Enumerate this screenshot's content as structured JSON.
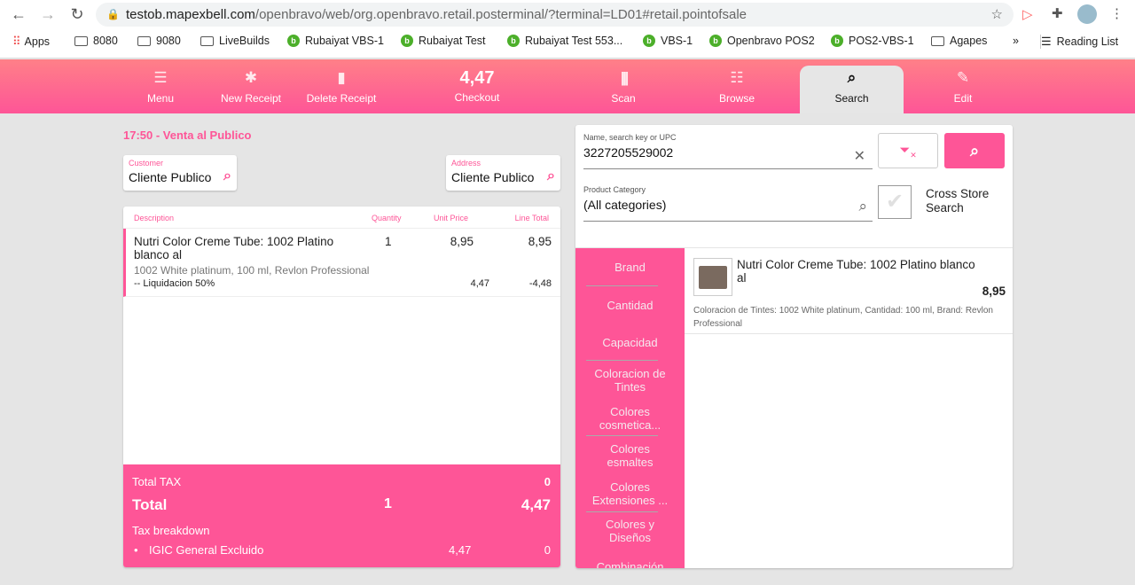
{
  "browser": {
    "url_host": "testob.mapexbell.com",
    "url_path": "/openbravo/web/org.openbravo.retail.posterminal/?terminal=LD01#retail.pointofsale",
    "bookmarks": [
      "Apps",
      "8080",
      "9080",
      "LiveBuilds",
      "Rubaiyat VBS-1",
      "Rubaiyat Test",
      "Rubaiyat Test 553...",
      "VBS-1",
      "Openbravo POS2",
      "POS2-VBS-1",
      "Agapes"
    ],
    "more": "»",
    "reading_list": "Reading List"
  },
  "toolbar": {
    "menu": "Menu",
    "new_receipt": "New Receipt",
    "delete_receipt": "Delete Receipt",
    "checkout_amount": "4,47",
    "checkout": "Checkout",
    "scan": "Scan",
    "browse": "Browse",
    "search": "Search",
    "edit": "Edit"
  },
  "receipt": {
    "header": "17:50 - Venta al Publico",
    "customer_label": "Customer",
    "customer": "Cliente Publico",
    "address_label": "Address",
    "address": "Cliente Publico",
    "columns": {
      "description": "Description",
      "quantity": "Quantity",
      "unit_price": "Unit Price",
      "line_total": "Line Total"
    },
    "lines": [
      {
        "name": "Nutri Color Creme Tube: 1002 Platino blanco al",
        "qty": "1",
        "price": "8,95",
        "total": "8,95",
        "attributes": "1002 White platinum, 100 ml, Revlon Professional",
        "promo": "-- Liquidacion 50%",
        "promo_price": "4,47",
        "promo_total": "-4,48"
      }
    ],
    "total_tax_label": "Total TAX",
    "total_tax": "0",
    "total_label": "Total",
    "total_qty": "1",
    "total": "4,47",
    "tax_breakdown_label": "Tax breakdown",
    "tax_name": "IGIC General Excluido",
    "tax_base": "4,47",
    "tax_amount": "0"
  },
  "search": {
    "name_label": "Name, search key or UPC",
    "name_value": "3227205529002",
    "category_label": "Product Category",
    "category_value": "(All categories)",
    "cross_store": "Cross Store Search",
    "categories": [
      "Brand",
      "Cantidad",
      "Capacidad",
      "Coloracion de Tintes",
      "Colores cosmetica...",
      "Colores esmaltes",
      "Colores Extensiones ...",
      "Colores y Diseños",
      "Combinación"
    ],
    "results": [
      {
        "name": "Nutri Color Creme Tube: 1002 Platino blanco al",
        "price": "8,95",
        "description": "Coloracion de Tintes: 1002 White platinum, Cantidad: 100 ml, Brand: Revlon Professional"
      }
    ]
  },
  "colors": {
    "accent": "#fe5597"
  }
}
